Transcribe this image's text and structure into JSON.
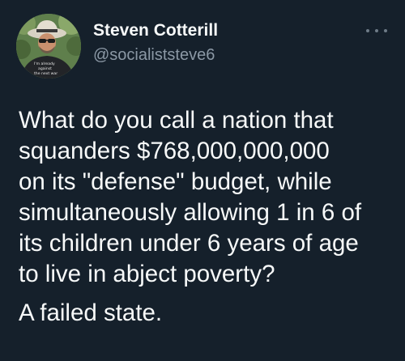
{
  "tweet": {
    "author": {
      "display_name": "Steven Cotterill",
      "handle": "@socialiststeve6",
      "avatar_shirt_text": [
        "I'm already",
        "against",
        "the next war"
      ]
    },
    "body": {
      "text": "What do you call a nation that\nsquanders $768,000,000,000\non its \"defense\" budget, while\nsimultaneously allowing 1 in 6 of\nits children under 6 years of age\nto live in abject poverty?",
      "conclusion": "A failed state."
    },
    "icons": {
      "more": "more-horizontal-icon"
    },
    "colors": {
      "background": "#15202b",
      "primary_text": "#f7f9f9",
      "secondary_text": "#8b98a5"
    }
  }
}
